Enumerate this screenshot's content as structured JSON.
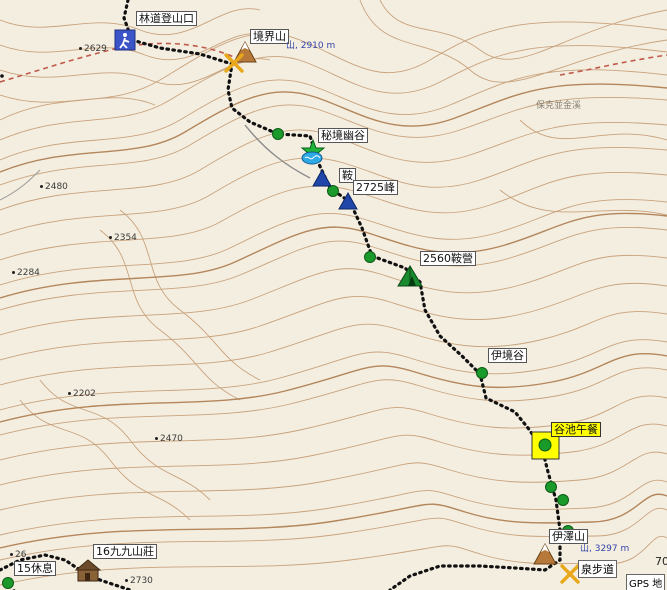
{
  "map": {
    "colors": {
      "background": "#f4eee1",
      "contour": "#c8a27c",
      "contour_index": "#b3865b",
      "trail": "#111111",
      "road_dash": "#c05a4a",
      "highlight": "#ffff00",
      "waypoint": "#1a9a2a"
    },
    "labels": {
      "trailhead": "林道登山口",
      "jingjie_shan": "境界山",
      "mijing_yougu": "秘境幽谷",
      "an": "鞍",
      "peak_2725": "2725峰",
      "camp_2560": "2560鞍營",
      "yijing_gu": "伊境谷",
      "guchi_lunch": "谷池午餐",
      "yize_shan": "伊澤山",
      "jiujiu_shanzhuang": "16九九山莊",
      "rest_15": "15休息",
      "trail_name": "泉步道",
      "gps_text": "GPS 地",
      "num_70": "70"
    },
    "elevations": {
      "e2629": "2629",
      "e2480": "2480",
      "e2354": "2354",
      "e2284": "2284",
      "e2202": "2202",
      "e2470": "2470",
      "e2730": "2730",
      "e26": "26"
    },
    "blue_text": {
      "jingjie_alt": "山, 2910 m",
      "yize_alt": "山, 3297 m"
    },
    "faint_text": {
      "place_top_right": "保克並金溪"
    },
    "icons": [
      "hiker-icon",
      "mountain-icon",
      "crossed-tools-icon",
      "star-icon",
      "water-icon",
      "triangle-icon",
      "tent-icon",
      "cabin-icon",
      "waypoint-dot-icon"
    ]
  }
}
